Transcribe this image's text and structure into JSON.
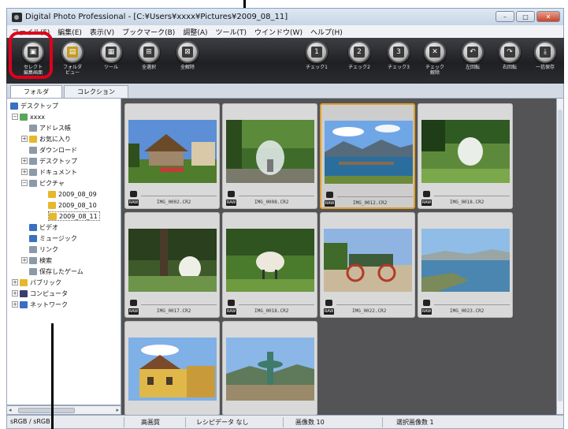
{
  "window": {
    "title": "Digital Photo Professional - [C:¥Users¥xxxx¥Pictures¥2009_08_11]",
    "buttons": [
      "–",
      "□",
      "✕"
    ]
  },
  "menu": [
    "ファイル(F)",
    "編集(E)",
    "表示(V)",
    "ブックマーク(B)",
    "調整(A)",
    "ツール(T)",
    "ウインドウ(W)",
    "ヘルプ(H)"
  ],
  "toolbar": {
    "items": [
      {
        "label": "セレクト\n編集画面",
        "icon": "select-edit-icon"
      },
      {
        "label": "フォルダ\nビュー",
        "icon": "folder-view-icon"
      },
      {
        "label": "ツール",
        "icon": "tool-icon"
      },
      {
        "label": "全選択",
        "icon": "select-all-icon"
      },
      {
        "label": "全解除",
        "icon": "deselect-all-icon"
      },
      {
        "label": "チェック1",
        "icon": "check1-icon"
      },
      {
        "label": "チェック2",
        "icon": "check2-icon"
      },
      {
        "label": "チェック3",
        "icon": "check3-icon"
      },
      {
        "label": "チェック\n解除",
        "icon": "check-clear-icon"
      },
      {
        "label": "左回転",
        "icon": "rotate-left-icon"
      },
      {
        "label": "右回転",
        "icon": "rotate-right-icon"
      },
      {
        "label": "一括保存",
        "icon": "batch-save-icon"
      }
    ]
  },
  "tabs": [
    "フォルダ",
    "コレクション (0)"
  ],
  "tree": [
    {
      "label": "デスクトップ",
      "depth": 0,
      "icon": "desktop-icon"
    },
    {
      "label": "xxxx",
      "depth": 1,
      "expander": "−",
      "icon": "user-folder-icon"
    },
    {
      "label": "アドレス帳",
      "depth": 2,
      "icon": "folder-icon"
    },
    {
      "label": "お気に入り",
      "depth": 2,
      "expander": "+",
      "icon": "folder-icon"
    },
    {
      "label": "ダウンロード",
      "depth": 2,
      "icon": "folder-icon"
    },
    {
      "label": "デスクトップ",
      "depth": 2,
      "expander": "+",
      "icon": "folder-icon"
    },
    {
      "label": "ドキュメント",
      "depth": 2,
      "expander": "+",
      "icon": "folder-icon"
    },
    {
      "label": "ピクチャ",
      "depth": 2,
      "expander": "−",
      "icon": "folder-icon"
    },
    {
      "label": "2009_08_09",
      "depth": 3,
      "icon": "folder-icon"
    },
    {
      "label": "2009_08_10",
      "depth": 3,
      "icon": "folder-icon"
    },
    {
      "label": "2009_08_11",
      "depth": 3,
      "icon": "folder-icon",
      "selected": true
    },
    {
      "label": "ビデオ",
      "depth": 2,
      "icon": "folder-icon"
    },
    {
      "label": "ミュージック",
      "depth": 2,
      "icon": "folder-icon"
    },
    {
      "label": "リンク",
      "depth": 2,
      "icon": "folder-icon"
    },
    {
      "label": "検索",
      "depth": 2,
      "expander": "+",
      "icon": "folder-icon"
    },
    {
      "label": "保存したゲーム",
      "depth": 2,
      "icon": "folder-icon"
    },
    {
      "label": "パブリック",
      "depth": 1,
      "expander": "+",
      "icon": "folder-icon"
    },
    {
      "label": "コンピュータ",
      "depth": 1,
      "expander": "+",
      "icon": "computer-icon"
    },
    {
      "label": "ネットワーク",
      "depth": 1,
      "expander": "+",
      "icon": "network-icon"
    }
  ],
  "thumbnails": [
    {
      "file": "IMG_0002.CR2",
      "raw": "RAW",
      "scene": "house"
    },
    {
      "file": "IMG_0008.CR2",
      "raw": "RAW",
      "scene": "fountain"
    },
    {
      "file": "IMG_0012.CR2",
      "raw": "RAW",
      "scene": "lake",
      "selected": true
    },
    {
      "file": "IMG_0018.CR2",
      "raw": "RAW",
      "scene": "egg-lawn"
    },
    {
      "file": "IMG_0017.CR2",
      "raw": "RAW",
      "scene": "tree-egg"
    },
    {
      "file": "IMG_0018.CR2",
      "raw": "RAW",
      "scene": "sheep"
    },
    {
      "file": "IMG_0022.CR2",
      "raw": "RAW",
      "scene": "wagon"
    },
    {
      "file": "IMG_0023.CR2",
      "raw": "RAW",
      "scene": "river"
    },
    {
      "scene": "building"
    },
    {
      "scene": "fountain2"
    }
  ],
  "status": {
    "color_space": "sRGB / sRGB",
    "quality": "高画質",
    "recipe": "レシピデータ なし",
    "count": "画像数 10",
    "selected": "選択画像数 1"
  }
}
